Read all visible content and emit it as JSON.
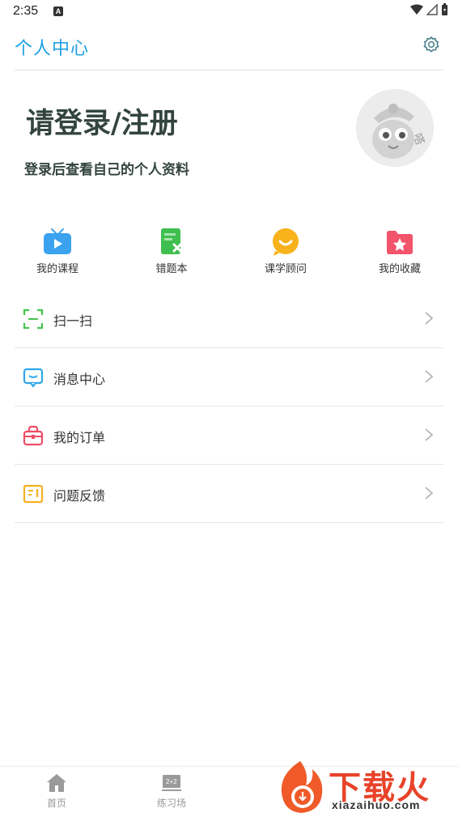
{
  "status_bar": {
    "time": "2:35",
    "notification_letter": "A"
  },
  "header": {
    "title": "个人中心",
    "settings_icon": "gear-icon"
  },
  "login": {
    "title": "请登录/注册",
    "subtitle": "登录后查看自己的个人资料"
  },
  "quick_actions": [
    {
      "label": "我的课程",
      "icon": "tv-play-icon",
      "color": "#3aa2ef"
    },
    {
      "label": "错题本",
      "icon": "wrong-book-icon",
      "color": "#3fbf4f"
    },
    {
      "label": "课学顾问",
      "icon": "smile-chat-icon",
      "color": "#f8b21b"
    },
    {
      "label": "我的收藏",
      "icon": "star-folder-icon",
      "color": "#f2546b"
    }
  ],
  "menu": [
    {
      "label": "扫一扫",
      "icon": "scan-icon",
      "color": "#43c34e"
    },
    {
      "label": "消息中心",
      "icon": "message-icon",
      "color": "#2fa7ea"
    },
    {
      "label": "我的订单",
      "icon": "order-bag-icon",
      "color": "#ef4d66"
    },
    {
      "label": "问题反馈",
      "icon": "feedback-icon",
      "color": "#f5b123"
    }
  ],
  "tabbar": [
    {
      "label": "首页",
      "icon": "home-icon"
    },
    {
      "label": "练习场",
      "icon": "practice-board-icon"
    }
  ],
  "watermark": {
    "brand": "下载火",
    "url": "xiazaihuo.com"
  }
}
